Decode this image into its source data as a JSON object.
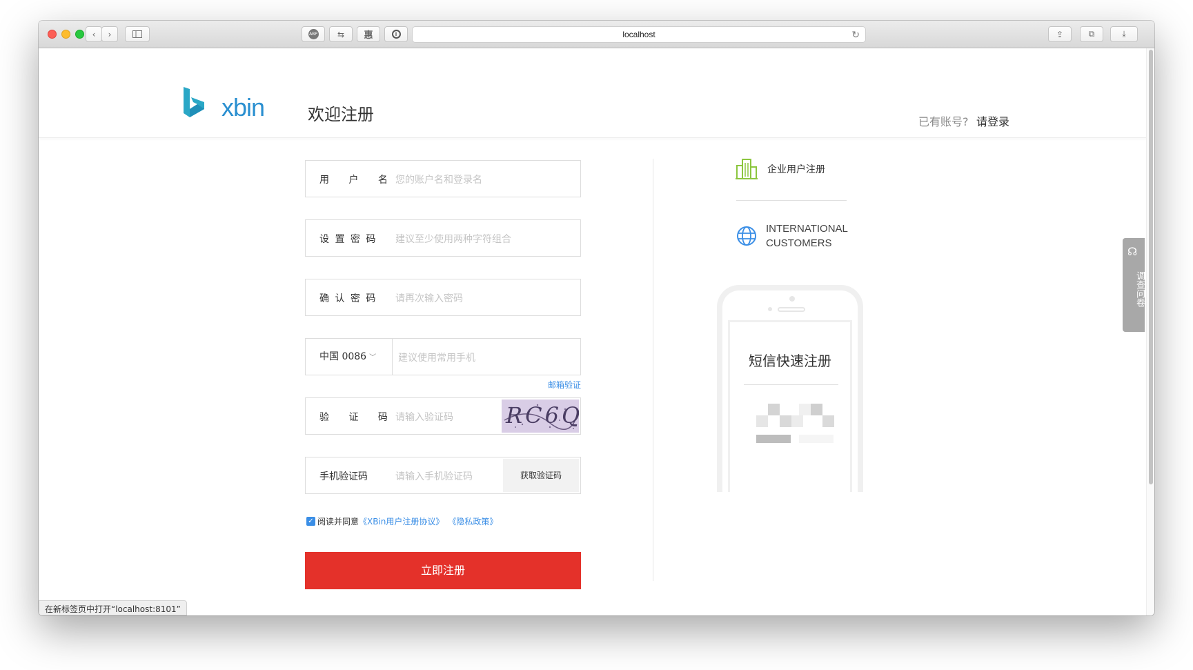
{
  "browser": {
    "address": "localhost",
    "status_text": "在新标签页中打开“localhost:8101”",
    "abp_label": "ABP"
  },
  "header": {
    "logo_text": "xbin",
    "title": "欢迎注册",
    "login_prompt": "已有账号?",
    "login_link": "请登录"
  },
  "form": {
    "username": {
      "label": "用 户 名",
      "placeholder": "您的账户名和登录名"
    },
    "password": {
      "label": "设 置 密 码",
      "placeholder": "建议至少使用两种字符组合"
    },
    "confirm": {
      "label": "确 认 密 码",
      "placeholder": "请再次输入密码"
    },
    "phone": {
      "country": "中国 0086",
      "placeholder": "建议使用常用手机"
    },
    "email_verify_link": "邮箱验证",
    "captcha": {
      "label": "验 证 码",
      "placeholder": "请输入验证码",
      "image_text": "RC6Q"
    },
    "sms": {
      "label": "手机验证码",
      "placeholder": "请输入手机验证码",
      "button": "获取验证码"
    },
    "agree": {
      "prefix": "阅读并同意",
      "agreement": "《XBin用户注册协议》",
      "privacy": "《隐私政策》",
      "checked": true
    },
    "submit": "立即注册"
  },
  "side": {
    "enterprise": "企业用户注册",
    "international_line1": "INTERNATIONAL",
    "international_line2": "CUSTOMERS",
    "sms_title": "短信快速注册",
    "survey": "调查问卷"
  },
  "colors": {
    "accent_blue": "#3a8ee6",
    "submit_red": "#e4312a",
    "logo_blue": "#2a8fd0",
    "enterprise_green": "#8cc63f"
  }
}
